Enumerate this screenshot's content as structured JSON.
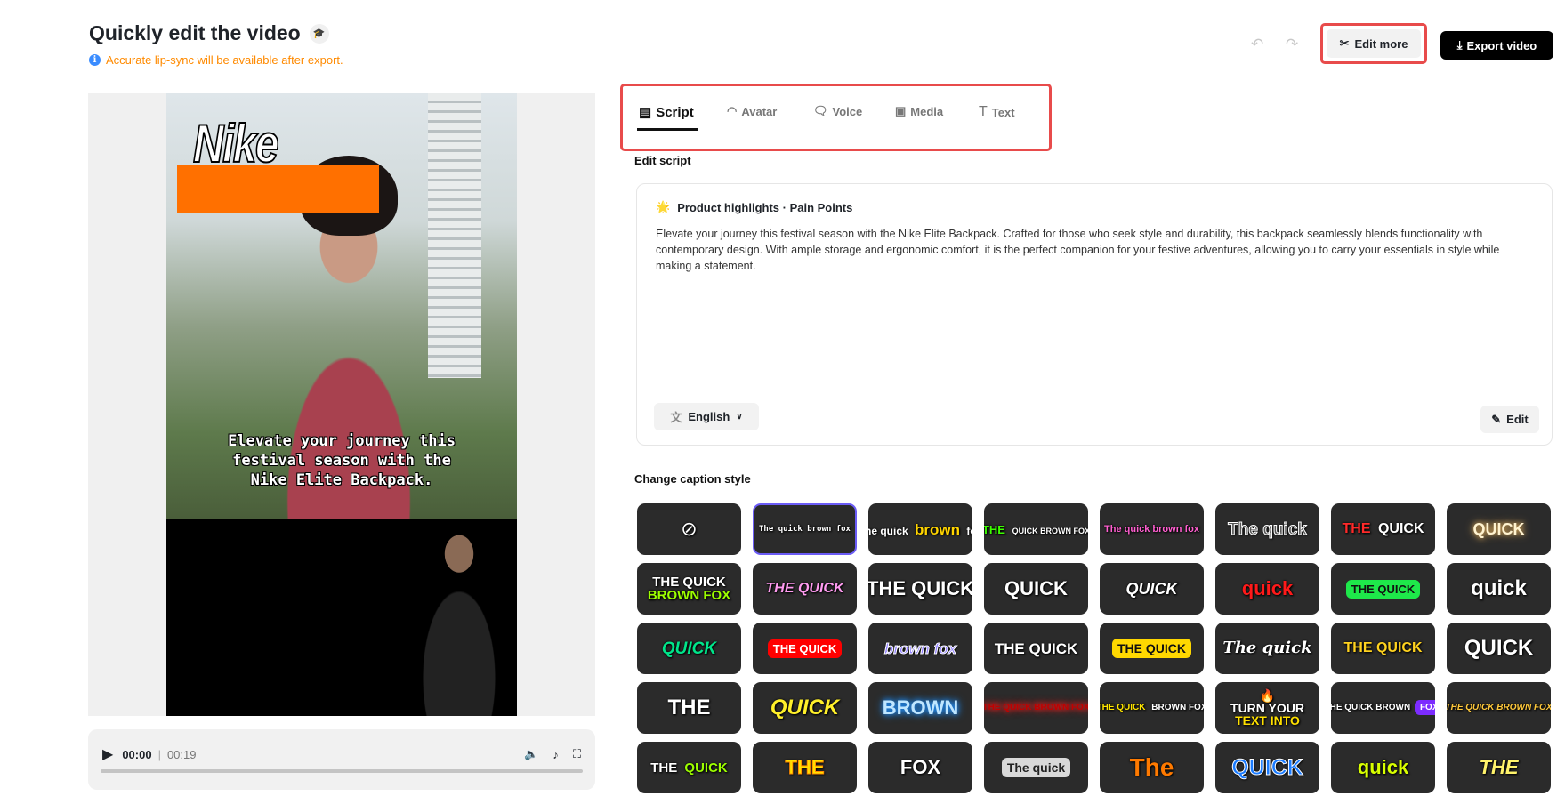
{
  "header": {
    "title": "Quickly edit the video",
    "notice": "Accurate lip-sync will be available after export.",
    "edit_more": "Edit more",
    "export": "Export video"
  },
  "tabs": [
    {
      "label": "Script",
      "icon": "script-icon"
    },
    {
      "label": "Avatar",
      "icon": "avatar-icon"
    },
    {
      "label": "Voice",
      "icon": "voice-icon"
    },
    {
      "label": "Media",
      "icon": "media-icon"
    },
    {
      "label": "Text",
      "icon": "text-icon"
    }
  ],
  "script": {
    "section_label": "Edit script",
    "heading": "Product highlights · Pain Points",
    "body": "Elevate your journey this festival season with the Nike Elite Backpack. Crafted for those who seek style and durability, this backpack seamlessly blends functionality with contemporary design. With ample storage and ergonomic comfort, it is the perfect companion for your festive adventures, allowing you to carry your essentials in style while making a statement.",
    "language": "English",
    "edit_label": "Edit"
  },
  "video": {
    "brand_text": "Nike",
    "caption_lines": [
      "Elevate your journey this",
      "festival season with the",
      "Nike Elite Backpack."
    ],
    "current_time": "00:00",
    "duration": "00:19",
    "progress": 0
  },
  "captions": {
    "label": "Change caption style",
    "selected_index": 1,
    "tiles": [
      {
        "none": true
      },
      {
        "parts": [
          {
            "t": "The quick brown fox",
            "c": "#ffffff"
          }
        ],
        "s": 9,
        "mono": true
      },
      {
        "parts": [
          {
            "t": "The quick ",
            "c": "#ffffff"
          },
          {
            "t": "brown",
            "c": "#ffd400",
            "s": 17
          },
          {
            "t": " fox",
            "c": "#ffffff"
          }
        ],
        "s": 12
      },
      {
        "parts": [
          {
            "t": "THE ",
            "c": "#3cff00",
            "s": 13
          },
          {
            "t": "QUICK BROWN FOX",
            "c": "#ffffff"
          }
        ],
        "s": 9
      },
      {
        "parts": [
          {
            "t": "The quick brown fox",
            "c": "#ff5fd0"
          }
        ],
        "s": 11
      },
      {
        "parts": [
          {
            "t": "The quick",
            "c": "#555555",
            "stroke": "#ffffff"
          }
        ],
        "s": 19
      },
      {
        "parts": [
          {
            "t": "THE ",
            "c": "#ff2a2a"
          },
          {
            "t": "QUICK",
            "c": "#ffffff"
          }
        ],
        "s": 16
      },
      {
        "parts": [
          {
            "t": "QUICK",
            "c": "#fff3d0",
            "glow": "#d9a85a"
          }
        ],
        "s": 18
      },
      {
        "lines": [
          [
            {
              "t": "THE QUICK",
              "c": "#ffffff"
            }
          ],
          [
            {
              "t": "BROWN FOX",
              "c": "#9dff00"
            }
          ]
        ],
        "s": 15
      },
      {
        "parts": [
          {
            "t": "THE QUICK",
            "c": "#ff9bf0"
          }
        ],
        "s": 16,
        "it": true
      },
      {
        "parts": [
          {
            "t": "THE QUICK",
            "c": "#ffffff"
          }
        ],
        "s": 22
      },
      {
        "parts": [
          {
            "t": "QUICK",
            "c": "#ffffff"
          }
        ],
        "s": 22
      },
      {
        "parts": [
          {
            "t": "QUICK",
            "c": "#ffffff"
          }
        ],
        "s": 18,
        "it": true
      },
      {
        "parts": [
          {
            "t": "quick",
            "c": "#ff1a1a"
          }
        ],
        "s": 22
      },
      {
        "parts": [
          {
            "t": "THE QUICK",
            "c": "#111111",
            "bg": "#1ee84a"
          }
        ],
        "s": 13
      },
      {
        "parts": [
          {
            "t": "quick",
            "c": "#ffffff"
          }
        ],
        "s": 24
      },
      {
        "parts": [
          {
            "t": "QUICK",
            "c": "#00e58a"
          }
        ],
        "s": 19,
        "it": true
      },
      {
        "parts": [
          {
            "t": "THE QUICK",
            "c": "#ffffff",
            "bg": "#ff0000"
          }
        ],
        "s": 13
      },
      {
        "parts": [
          {
            "t": "brown fox",
            "c": "#8e7dff",
            "stroke": "#ffffff"
          }
        ],
        "s": 17,
        "it": true
      },
      {
        "parts": [
          {
            "t": "THE QUICK",
            "c": "#ffffff"
          }
        ],
        "s": 17
      },
      {
        "parts": [
          {
            "t": "THE QUICK",
            "c": "#111111",
            "bg": "#ffd800"
          }
        ],
        "s": 14
      },
      {
        "parts": [
          {
            "t": "The quick",
            "c": "#ffffff"
          }
        ],
        "s": 18,
        "it": true,
        "serif": true
      },
      {
        "parts": [
          {
            "t": "THE QUICK",
            "c": "#ffd21f"
          }
        ],
        "s": 16
      },
      {
        "parts": [
          {
            "t": "QUICK",
            "c": "#ffffff"
          }
        ],
        "s": 24
      },
      {
        "parts": [
          {
            "t": "THE",
            "c": "#ffffff"
          }
        ],
        "s": 24
      },
      {
        "parts": [
          {
            "t": "QUICK",
            "c": "#fff02a"
          }
        ],
        "s": 24,
        "it": true
      },
      {
        "parts": [
          {
            "t": "BROWN",
            "c": "#bfe6ff",
            "glow": "#1e90ff"
          }
        ],
        "s": 22
      },
      {
        "parts": [
          {
            "t": "THE QUICK BROWN FOX",
            "c": "#c00000",
            "glow": "#ff2020"
          }
        ],
        "s": 10
      },
      {
        "parts": [
          {
            "t": "THE QUICK ",
            "c": "#ffe600"
          },
          {
            "t": "BROWN FOX",
            "c": "#ffffff"
          }
        ],
        "s": 10
      },
      {
        "emoji": "🔥",
        "lines": [
          [
            {
              "t": "TURN YOUR",
              "c": "#ffffff"
            }
          ],
          [
            {
              "t": "TEXT INTO",
              "c": "#ffe000"
            }
          ]
        ],
        "s": 14
      },
      {
        "parts": [
          {
            "t": "THE QUICK BROWN ",
            "c": "#ffffff"
          },
          {
            "t": "FOX",
            "c": "#ffffff",
            "bg": "#7c2cff"
          }
        ],
        "s": 10
      },
      {
        "parts": [
          {
            "t": "THE QUICK BROWN FOX",
            "c": "#ffc93c"
          }
        ],
        "s": 10,
        "it": true
      },
      {
        "parts": [
          {
            "t": "THE ",
            "c": "#ffffff"
          },
          {
            "t": "QUICK",
            "c": "#9dff00"
          }
        ],
        "s": 15
      },
      {
        "parts": [
          {
            "t": "THE",
            "c": "#ffe000",
            "stroke": "#ff8a00"
          }
        ],
        "s": 22
      },
      {
        "parts": [
          {
            "t": "FOX",
            "c": "#ffffff"
          }
        ],
        "s": 22
      },
      {
        "parts": [
          {
            "t": "The quick",
            "c": "#222222",
            "bg": "#d9d9d9"
          }
        ],
        "s": 14
      },
      {
        "parts": [
          {
            "t": "The",
            "c": "#ff7a00"
          }
        ],
        "s": 28
      },
      {
        "parts": [
          {
            "t": "QUICK",
            "c": "#1a7bff",
            "stroke": "#ffffff"
          }
        ],
        "s": 25
      },
      {
        "parts": [
          {
            "t": "quick",
            "c": "#d8ff00"
          }
        ],
        "s": 22
      },
      {
        "parts": [
          {
            "t": "THE",
            "c": "#fff36b"
          }
        ],
        "s": 22,
        "it": true
      }
    ]
  }
}
